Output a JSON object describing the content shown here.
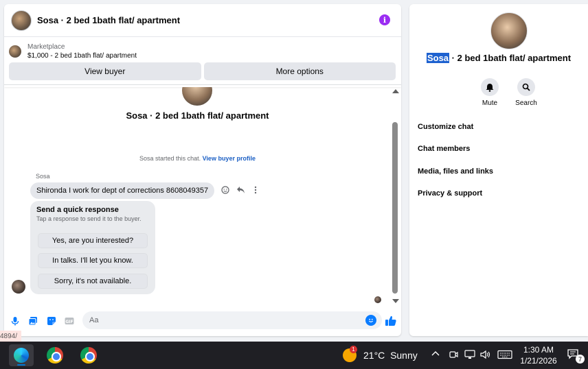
{
  "chat": {
    "title": "Sosa · 2 bed 1bath flat/ apartment",
    "marketplace_label": "Marketplace",
    "listing": "$1,000 - 2 bed 1bath flat/ apartment",
    "buttons": {
      "view_buyer": "View buyer",
      "more_options": "More options"
    },
    "center_title": "Sosa · 2 bed 1bath flat/ apartment",
    "started_text": "Sosa started this chat.",
    "view_buyer_profile": "View buyer profile",
    "sender": "Sosa",
    "message": "Shironda I work for dept of corrections 8608049357",
    "quick_response": {
      "title": "Send a quick response",
      "subtitle": "Tap a response to send it to the buyer.",
      "options": [
        "Yes, are you interested?",
        "In talks. I'll let you know.",
        "Sorry, it's not available."
      ]
    },
    "composer_placeholder": "Aa"
  },
  "info_panel": {
    "title_highlight": "Sosa",
    "title_rest": " · 2 bed 1bath flat/ apartment",
    "actions": {
      "mute": "Mute",
      "search": "Search"
    },
    "menu": [
      "Customize chat",
      "Chat members",
      "Media, files and links",
      "Privacy & support"
    ]
  },
  "url_fragment": "4894/",
  "taskbar": {
    "weather_badge": "1",
    "temperature": "21°C",
    "condition": "Sunny",
    "time": "1:30 AM",
    "date": "1/21/2026",
    "notifications": "7"
  },
  "colors": {
    "messenger_blue": "#0a7cff",
    "info_purple": "#9b2df2",
    "link_blue": "#1b5fc4"
  }
}
